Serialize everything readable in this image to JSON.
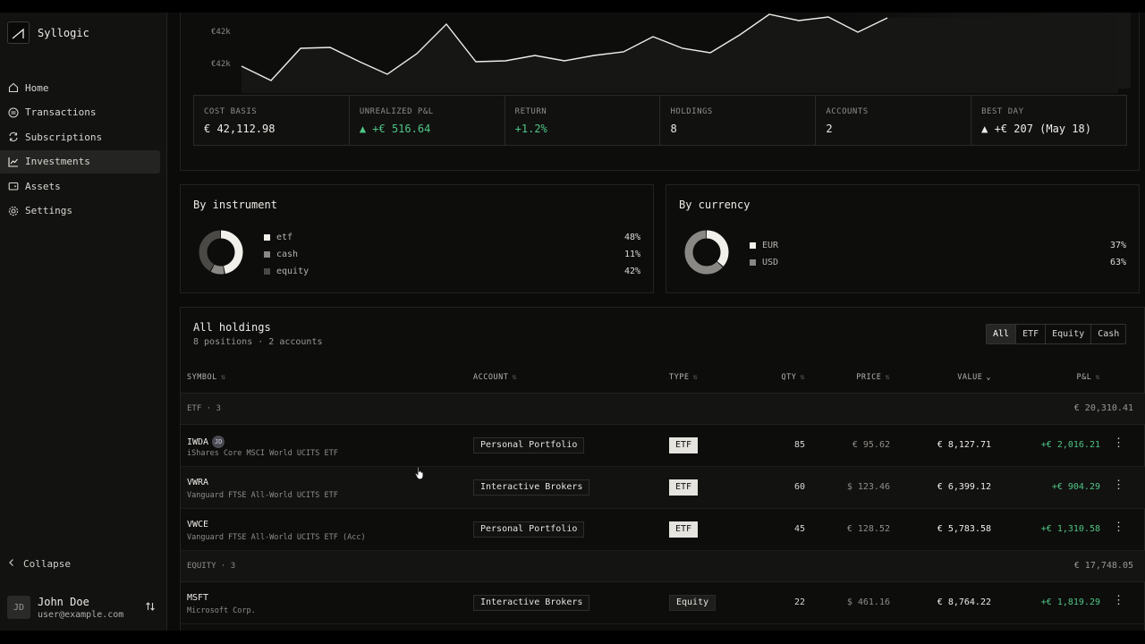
{
  "app": {
    "name": "Syllogic"
  },
  "sidebar": {
    "items": [
      {
        "label": "Home",
        "icon": "home-icon"
      },
      {
        "label": "Transactions",
        "icon": "transactions-icon"
      },
      {
        "label": "Subscriptions",
        "icon": "subscriptions-icon"
      },
      {
        "label": "Investments",
        "icon": "chart-line-icon",
        "active": true
      },
      {
        "label": "Assets",
        "icon": "wallet-icon"
      },
      {
        "label": "Settings",
        "icon": "gear-icon"
      }
    ],
    "collapse_label": "Collapse",
    "user": {
      "initials": "JD",
      "name": "John Doe",
      "email": "user@example.com"
    }
  },
  "portfolio_chart": {
    "y_tick_labels": [
      "€42k",
      "€42k"
    ]
  },
  "stats": [
    {
      "label": "COST BASIS",
      "value": "€ 42,112.98"
    },
    {
      "label": "UNREALIZED P&L",
      "value": "▲ +€ 516.64",
      "positive": true
    },
    {
      "label": "RETURN",
      "value": "+1.2%",
      "positive": true
    },
    {
      "label": "HOLDINGS",
      "value": "8"
    },
    {
      "label": "ACCOUNTS",
      "value": "2"
    },
    {
      "label": "BEST DAY",
      "value": "▲ +€ 207 (May 18)"
    }
  ],
  "by_instrument": {
    "title": "By instrument",
    "items": [
      {
        "name": "etf",
        "pct": "48%",
        "value": 48,
        "color": "#f2f0ea"
      },
      {
        "name": "cash",
        "pct": "11%",
        "value": 11,
        "color": "#8a8884"
      },
      {
        "name": "equity",
        "pct": "42%",
        "value": 42,
        "color": "#4a4946"
      }
    ]
  },
  "by_currency": {
    "title": "By currency",
    "items": [
      {
        "name": "EUR",
        "pct": "37%",
        "value": 37,
        "color": "#f2f0ea"
      },
      {
        "name": "USD",
        "pct": "63%",
        "value": 63,
        "color": "#8a8884"
      }
    ]
  },
  "holdings": {
    "title": "All holdings",
    "subtitle": "8 positions · 2 accounts",
    "filters": [
      "All",
      "ETF",
      "Equity",
      "Cash"
    ],
    "active_filter": "All",
    "columns": {
      "symbol": "SYMBOL",
      "account": "ACCOUNT",
      "type": "TYPE",
      "qty": "QTY",
      "price": "PRICE",
      "value": "VALUE",
      "pnl": "P&L"
    },
    "groups": [
      {
        "label": "ETF · 3",
        "total": "€ 20,310.41",
        "rows": [
          {
            "symbol": "IWDA",
            "badge": "JD",
            "name": "iShares Core MSCI World UCITS ETF",
            "account": "Personal Portfolio",
            "type": "ETF",
            "qty": "85",
            "price": "€ 95.62",
            "value": "€ 8,127.71",
            "pnl": "+€ 2,016.21"
          },
          {
            "symbol": "VWRA",
            "name": "Vanguard FTSE All-World UCITS ETF",
            "account": "Interactive Brokers",
            "type": "ETF",
            "qty": "60",
            "price": "$ 123.46",
            "value": "€ 6,399.12",
            "pnl": "+€ 904.29"
          },
          {
            "symbol": "VWCE",
            "name": "Vanguard FTSE All-World UCITS ETF (Acc)",
            "account": "Personal Portfolio",
            "type": "ETF",
            "qty": "45",
            "price": "€ 128.52",
            "value": "€ 5,783.58",
            "pnl": "+€ 1,310.58"
          }
        ]
      },
      {
        "label": "EQUITY · 3",
        "total": "€ 17,748.05",
        "rows": [
          {
            "symbol": "MSFT",
            "name": "Microsoft Corp.",
            "account": "Interactive Brokers",
            "type": "Equity",
            "qty": "22",
            "price": "$ 461.16",
            "value": "€ 8,764.22",
            "pnl": "+€ 1,819.29"
          }
        ]
      }
    ]
  }
}
